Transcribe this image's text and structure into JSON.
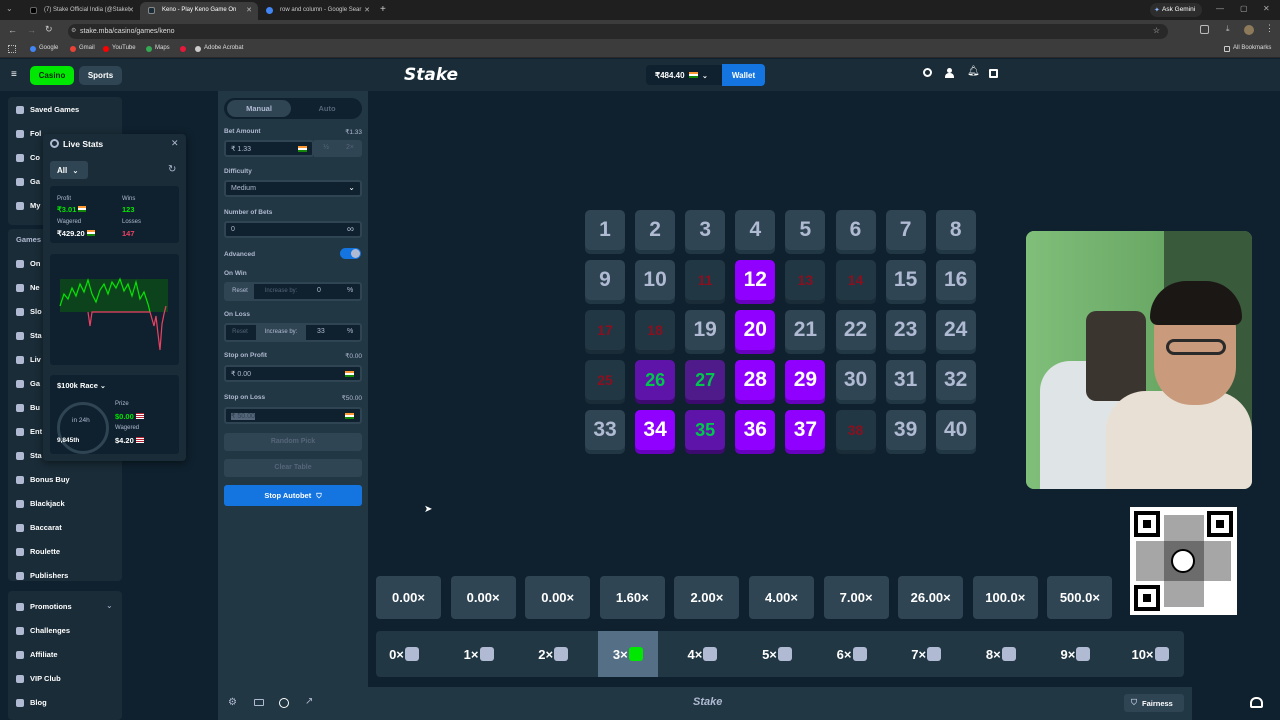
{
  "browser": {
    "tabs": [
      {
        "title": "(7) Stake Official India (@StakeI",
        "active": false
      },
      {
        "title": "Keno - Play Keno Game On",
        "active": true
      },
      {
        "title": "row and column - Google Sear",
        "active": false
      }
    ],
    "new_tab": "+",
    "ask_gemini": "Ask Gemini",
    "url": "stake.mba/casino/games/keno",
    "bookmarks": [
      "Google",
      "Gmail",
      "YouTube",
      "Maps",
      "Adobe Acrobat"
    ],
    "all_bookmarks": "All Bookmarks"
  },
  "header": {
    "casino": "Casino",
    "sports": "Sports",
    "logo": "Stake",
    "balance": "₹484.40",
    "wallet": "Wallet"
  },
  "sidebar": {
    "top_items": [
      {
        "label": "Saved Games",
        "icon": "bookmark-icon"
      },
      {
        "label": "Fol",
        "icon": "heart-icon"
      },
      {
        "label": "Co",
        "icon": "coin-icon"
      },
      {
        "label": "Ga",
        "icon": "clock-icon"
      },
      {
        "label": "My",
        "icon": "ticket-icon"
      }
    ],
    "games_heading": "Games",
    "game_items": [
      {
        "label": "On"
      },
      {
        "label": "Ne"
      },
      {
        "label": "Slo"
      },
      {
        "label": "Sta"
      },
      {
        "label": "Liv"
      },
      {
        "label": "Ga"
      },
      {
        "label": "Bu"
      },
      {
        "label": "Ent"
      },
      {
        "label": "Sta"
      },
      {
        "label": "Bonus Buy"
      },
      {
        "label": "Blackjack"
      },
      {
        "label": "Baccarat"
      },
      {
        "label": "Roulette"
      },
      {
        "label": "Publishers"
      }
    ],
    "bottom_items": [
      {
        "label": "Promotions"
      },
      {
        "label": "Challenges"
      },
      {
        "label": "Affiliate"
      },
      {
        "label": "VIP Club"
      },
      {
        "label": "Blog"
      }
    ]
  },
  "live_stats": {
    "title": "Live Stats",
    "filter": "All",
    "profit_label": "Profit",
    "profit": "₹3.01",
    "wins_label": "Wins",
    "wins": "123",
    "wagered_label": "Wagered",
    "wagered": "₹429.20",
    "losses_label": "Losses",
    "losses": "147",
    "race_title": "$100k Race",
    "race_timer": "in 24h",
    "race_rank": "9,845th",
    "prize_label": "Prize",
    "prize": "$0.00",
    "race_wagered_label": "Wagered",
    "race_wagered": "$4.20"
  },
  "controls": {
    "tab_manual": "Manual",
    "tab_auto": "Auto",
    "bet_amount_label": "Bet Amount",
    "bet_amount_right": "₹1.33",
    "bet_amount_value": "₹ 1.33",
    "half": "½",
    "double": "2×",
    "difficulty_label": "Difficulty",
    "difficulty_value": "Medium",
    "num_bets_label": "Number of Bets",
    "num_bets_value": "0",
    "infinity": "∞",
    "advanced_label": "Advanced",
    "on_win_label": "On Win",
    "reset": "Reset",
    "increase_by": "Increase by:",
    "on_win_value": "0",
    "percent": "%",
    "on_loss_label": "On Loss",
    "on_loss_value": "33",
    "stop_profit_label": "Stop on Profit",
    "stop_profit_right": "₹0.00",
    "stop_profit_value": "₹ 0.00",
    "stop_loss_label": "Stop on Loss",
    "stop_loss_right": "₹50.00",
    "stop_loss_value": "₹ 50.00",
    "random_pick": "Random Pick",
    "clear_table": "Clear Table",
    "stop_autobet": "Stop Autobet"
  },
  "board": {
    "tiles": [
      {
        "n": "1",
        "s": "normal"
      },
      {
        "n": "2",
        "s": "normal"
      },
      {
        "n": "3",
        "s": "normal"
      },
      {
        "n": "4",
        "s": "normal"
      },
      {
        "n": "5",
        "s": "normal"
      },
      {
        "n": "6",
        "s": "normal"
      },
      {
        "n": "7",
        "s": "normal"
      },
      {
        "n": "8",
        "s": "normal"
      },
      {
        "n": "9",
        "s": "normal"
      },
      {
        "n": "10",
        "s": "normal"
      },
      {
        "n": "11",
        "s": "miss"
      },
      {
        "n": "12",
        "s": "sel"
      },
      {
        "n": "13",
        "s": "miss"
      },
      {
        "n": "14",
        "s": "miss"
      },
      {
        "n": "15",
        "s": "normal"
      },
      {
        "n": "16",
        "s": "normal"
      },
      {
        "n": "17",
        "s": "miss"
      },
      {
        "n": "18",
        "s": "miss"
      },
      {
        "n": "19",
        "s": "normal"
      },
      {
        "n": "20",
        "s": "sel"
      },
      {
        "n": "21",
        "s": "normal"
      },
      {
        "n": "22",
        "s": "normal"
      },
      {
        "n": "23",
        "s": "normal"
      },
      {
        "n": "24",
        "s": "normal"
      },
      {
        "n": "25",
        "s": "miss"
      },
      {
        "n": "26",
        "s": "hit"
      },
      {
        "n": "27",
        "s": "hitlight"
      },
      {
        "n": "28",
        "s": "sel"
      },
      {
        "n": "29",
        "s": "sel"
      },
      {
        "n": "30",
        "s": "normal"
      },
      {
        "n": "31",
        "s": "normal"
      },
      {
        "n": "32",
        "s": "normal"
      },
      {
        "n": "33",
        "s": "normal"
      },
      {
        "n": "34",
        "s": "sel"
      },
      {
        "n": "35",
        "s": "hit"
      },
      {
        "n": "36",
        "s": "sel"
      },
      {
        "n": "37",
        "s": "sel"
      },
      {
        "n": "38",
        "s": "miss"
      },
      {
        "n": "39",
        "s": "normal"
      },
      {
        "n": "40",
        "s": "normal"
      }
    ],
    "payouts": [
      "0.00×",
      "0.00×",
      "0.00×",
      "1.60×",
      "2.00×",
      "4.00×",
      "7.00×",
      "26.00×",
      "100.0×",
      "500.0×"
    ],
    "hits": [
      "0×",
      "1×",
      "2×",
      "3×",
      "4×",
      "5×",
      "6×",
      "7×",
      "8×",
      "9×",
      "10×"
    ],
    "active_hit_index": 3
  },
  "footer": {
    "logo": "Stake",
    "fairness": "Fairness"
  },
  "colors": {
    "bg": "#0f212e",
    "panel": "#213743",
    "selected": "#9000ff",
    "accent": "#1475e1",
    "green": "#00e701"
  }
}
